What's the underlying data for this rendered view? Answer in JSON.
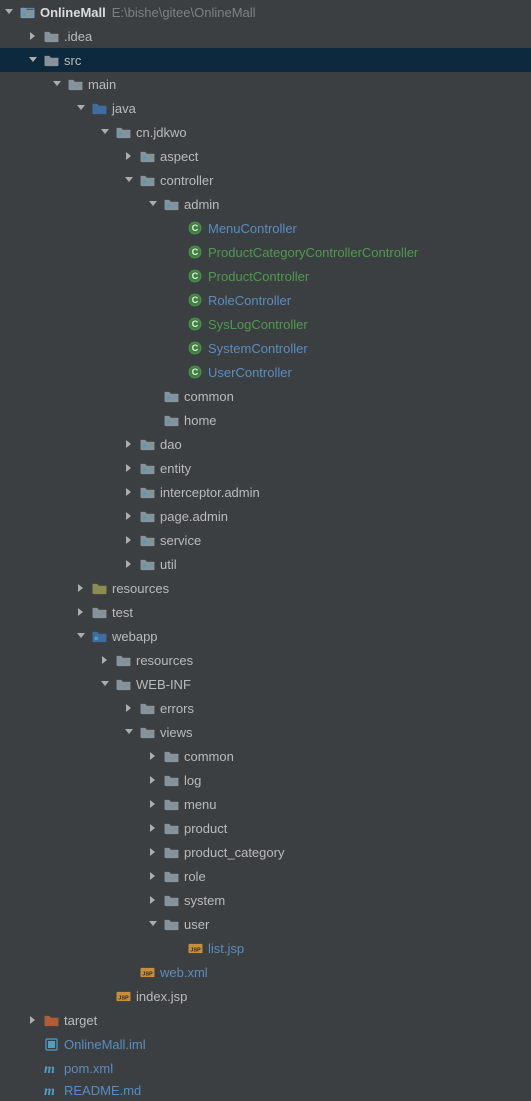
{
  "project": {
    "name": "OnlineMall",
    "path": "E:\\bishe\\gitee\\OnlineMall"
  },
  "nodes": [
    {
      "depth": 0,
      "arrow": "down",
      "icon": "project",
      "label": "OnlineMall",
      "labelClass": "bold white",
      "subtitle": "E:\\bishe\\gitee\\OnlineMall",
      "selected": false,
      "interact": true,
      "name": "project-root"
    },
    {
      "depth": 1,
      "arrow": "right",
      "icon": "folder-grey",
      "label": ".idea",
      "selected": false,
      "interact": true,
      "name": "folder-idea"
    },
    {
      "depth": 1,
      "arrow": "down",
      "icon": "folder-grey",
      "label": "src",
      "selected": true,
      "interact": true,
      "name": "folder-src"
    },
    {
      "depth": 2,
      "arrow": "down",
      "icon": "folder-grey",
      "label": "main",
      "selected": false,
      "interact": true,
      "name": "folder-main"
    },
    {
      "depth": 3,
      "arrow": "down",
      "icon": "source-root",
      "label": "java",
      "selected": false,
      "interact": true,
      "name": "folder-java"
    },
    {
      "depth": 4,
      "arrow": "down",
      "icon": "package",
      "label": "cn.jdkwo",
      "selected": false,
      "interact": true,
      "name": "pkg-cn-jdkwo"
    },
    {
      "depth": 5,
      "arrow": "right",
      "icon": "package",
      "label": "aspect",
      "selected": false,
      "interact": true,
      "name": "pkg-aspect"
    },
    {
      "depth": 5,
      "arrow": "down",
      "icon": "package",
      "label": "controller",
      "selected": false,
      "interact": true,
      "name": "pkg-controller"
    },
    {
      "depth": 6,
      "arrow": "down",
      "icon": "package",
      "label": "admin",
      "selected": false,
      "interact": true,
      "name": "pkg-admin"
    },
    {
      "depth": 7,
      "arrow": "blank",
      "icon": "class",
      "label": "MenuController",
      "labelClass": "link",
      "selected": false,
      "interact": true,
      "name": "class-menucontroller"
    },
    {
      "depth": 7,
      "arrow": "blank",
      "icon": "class",
      "label": "ProductCategoryControllerController",
      "labelClass": "green",
      "selected": false,
      "interact": true,
      "name": "class-productcategory"
    },
    {
      "depth": 7,
      "arrow": "blank",
      "icon": "class",
      "label": "ProductController",
      "labelClass": "green",
      "selected": false,
      "interact": true,
      "name": "class-productcontroller"
    },
    {
      "depth": 7,
      "arrow": "blank",
      "icon": "class",
      "label": "RoleController",
      "labelClass": "link",
      "selected": false,
      "interact": true,
      "name": "class-rolecontroller"
    },
    {
      "depth": 7,
      "arrow": "blank",
      "icon": "class",
      "label": "SysLogController",
      "labelClass": "green",
      "selected": false,
      "interact": true,
      "name": "class-syslogcontroller"
    },
    {
      "depth": 7,
      "arrow": "blank",
      "icon": "class",
      "label": "SystemController",
      "labelClass": "link",
      "selected": false,
      "interact": true,
      "name": "class-systemcontroller"
    },
    {
      "depth": 7,
      "arrow": "blank",
      "icon": "class",
      "label": "UserController",
      "labelClass": "link",
      "selected": false,
      "interact": true,
      "name": "class-usercontroller"
    },
    {
      "depth": 6,
      "arrow": "blank",
      "icon": "package",
      "label": "common",
      "selected": false,
      "interact": true,
      "name": "pkg-common"
    },
    {
      "depth": 6,
      "arrow": "blank",
      "icon": "package",
      "label": "home",
      "selected": false,
      "interact": true,
      "name": "pkg-home"
    },
    {
      "depth": 5,
      "arrow": "right",
      "icon": "package",
      "label": "dao",
      "selected": false,
      "interact": true,
      "name": "pkg-dao"
    },
    {
      "depth": 5,
      "arrow": "right",
      "icon": "package",
      "label": "entity",
      "selected": false,
      "interact": true,
      "name": "pkg-entity"
    },
    {
      "depth": 5,
      "arrow": "right",
      "icon": "package",
      "label": "interceptor.admin",
      "selected": false,
      "interact": true,
      "name": "pkg-interceptor-admin"
    },
    {
      "depth": 5,
      "arrow": "right",
      "icon": "package",
      "label": "page.admin",
      "selected": false,
      "interact": true,
      "name": "pkg-page-admin"
    },
    {
      "depth": 5,
      "arrow": "right",
      "icon": "package",
      "label": "service",
      "selected": false,
      "interact": true,
      "name": "pkg-service"
    },
    {
      "depth": 5,
      "arrow": "right",
      "icon": "package",
      "label": "util",
      "selected": false,
      "interact": true,
      "name": "pkg-util"
    },
    {
      "depth": 3,
      "arrow": "right",
      "icon": "resource-root",
      "label": "resources",
      "selected": false,
      "interact": true,
      "name": "folder-resources-main"
    },
    {
      "depth": 3,
      "arrow": "right",
      "icon": "folder-grey",
      "label": "test",
      "selected": false,
      "interact": true,
      "name": "folder-test"
    },
    {
      "depth": 3,
      "arrow": "down",
      "icon": "web-root",
      "label": "webapp",
      "selected": false,
      "interact": true,
      "name": "folder-webapp"
    },
    {
      "depth": 4,
      "arrow": "right",
      "icon": "folder-grey",
      "label": "resources",
      "selected": false,
      "interact": true,
      "name": "folder-webapp-resources"
    },
    {
      "depth": 4,
      "arrow": "down",
      "icon": "folder-grey",
      "label": "WEB-INF",
      "selected": false,
      "interact": true,
      "name": "folder-web-inf"
    },
    {
      "depth": 5,
      "arrow": "right",
      "icon": "folder-grey",
      "label": "errors",
      "selected": false,
      "interact": true,
      "name": "folder-errors"
    },
    {
      "depth": 5,
      "arrow": "down",
      "icon": "folder-grey",
      "label": "views",
      "selected": false,
      "interact": true,
      "name": "folder-views"
    },
    {
      "depth": 6,
      "arrow": "right",
      "icon": "folder-grey",
      "label": "common",
      "selected": false,
      "interact": true,
      "name": "folder-views-common"
    },
    {
      "depth": 6,
      "arrow": "right",
      "icon": "folder-grey",
      "label": "log",
      "selected": false,
      "interact": true,
      "name": "folder-views-log"
    },
    {
      "depth": 6,
      "arrow": "right",
      "icon": "folder-grey",
      "label": "menu",
      "selected": false,
      "interact": true,
      "name": "folder-views-menu"
    },
    {
      "depth": 6,
      "arrow": "right",
      "icon": "folder-grey",
      "label": "product",
      "selected": false,
      "interact": true,
      "name": "folder-views-product"
    },
    {
      "depth": 6,
      "arrow": "right",
      "icon": "folder-grey",
      "label": "product_category",
      "selected": false,
      "interact": true,
      "name": "folder-views-product-category"
    },
    {
      "depth": 6,
      "arrow": "right",
      "icon": "folder-grey",
      "label": "role",
      "selected": false,
      "interact": true,
      "name": "folder-views-role"
    },
    {
      "depth": 6,
      "arrow": "right",
      "icon": "folder-grey",
      "label": "system",
      "selected": false,
      "interact": true,
      "name": "folder-views-system"
    },
    {
      "depth": 6,
      "arrow": "down",
      "icon": "folder-grey",
      "label": "user",
      "selected": false,
      "interact": true,
      "name": "folder-views-user"
    },
    {
      "depth": 7,
      "arrow": "blank",
      "icon": "jsp",
      "label": "list.jsp",
      "labelClass": "link",
      "selected": false,
      "interact": true,
      "name": "file-list-jsp"
    },
    {
      "depth": 5,
      "arrow": "blank",
      "icon": "jsp",
      "label": "web.xml",
      "labelClass": "link",
      "selected": false,
      "interact": true,
      "name": "file-web-xml"
    },
    {
      "depth": 4,
      "arrow": "blank",
      "icon": "jsp",
      "label": "index.jsp",
      "selected": false,
      "interact": true,
      "name": "file-index-jsp"
    },
    {
      "depth": 1,
      "arrow": "right",
      "icon": "excluded",
      "label": "target",
      "selected": false,
      "interact": true,
      "name": "folder-target"
    },
    {
      "depth": 1,
      "arrow": "blank",
      "icon": "iml",
      "label": "OnlineMall.iml",
      "labelClass": "link",
      "selected": false,
      "interact": true,
      "name": "file-iml"
    },
    {
      "depth": 1,
      "arrow": "blank",
      "icon": "pom",
      "label": "pom.xml",
      "labelClass": "link",
      "selected": false,
      "interact": true,
      "name": "file-pom"
    },
    {
      "depth": 1,
      "arrow": "blank",
      "icon": "pom",
      "label": "README.md",
      "labelClass": "link",
      "selected": false,
      "interact": true,
      "name": "file-readme",
      "cut": true
    }
  ],
  "colors": {
    "background": "#3c3f41",
    "selection": "#0d293e",
    "text": "#bbbbbb",
    "path": "#808080",
    "link": "#5a8dc0",
    "green": "#4e9a4e"
  }
}
